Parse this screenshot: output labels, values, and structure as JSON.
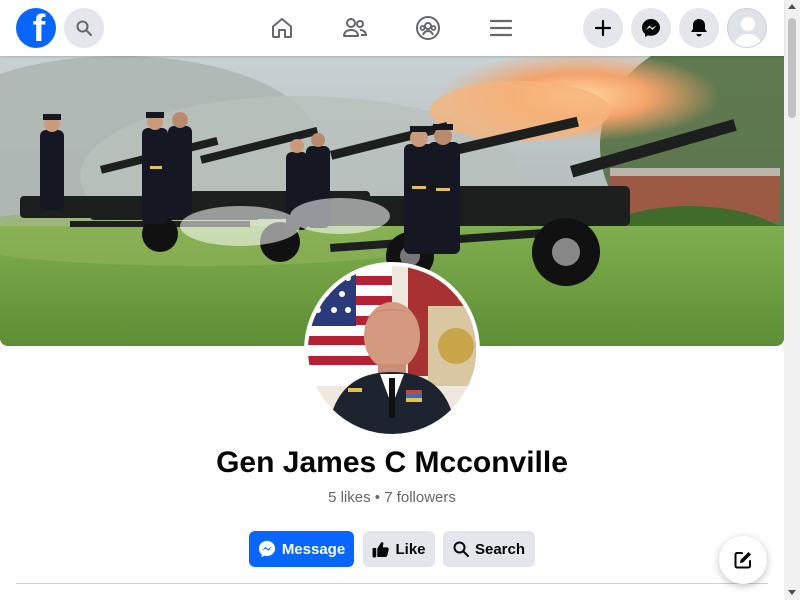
{
  "header": {
    "logo_letter": "f",
    "icons": [
      "facebook-logo-icon",
      "search-icon",
      "home-icon",
      "friends-icon",
      "groups-icon",
      "menu-icon",
      "create-icon",
      "messenger-icon",
      "notifications-icon",
      "account-avatar"
    ]
  },
  "profile": {
    "name": "Gen James C Mcconville",
    "stats": "5 likes • 7 followers"
  },
  "actions": {
    "message_label": "Message",
    "like_label": "Like",
    "search_label": "Search"
  },
  "colors": {
    "brand": "#0866ff",
    "button_gray": "#e4e6eb",
    "text_primary": "#050505",
    "text_secondary": "#65676b"
  }
}
